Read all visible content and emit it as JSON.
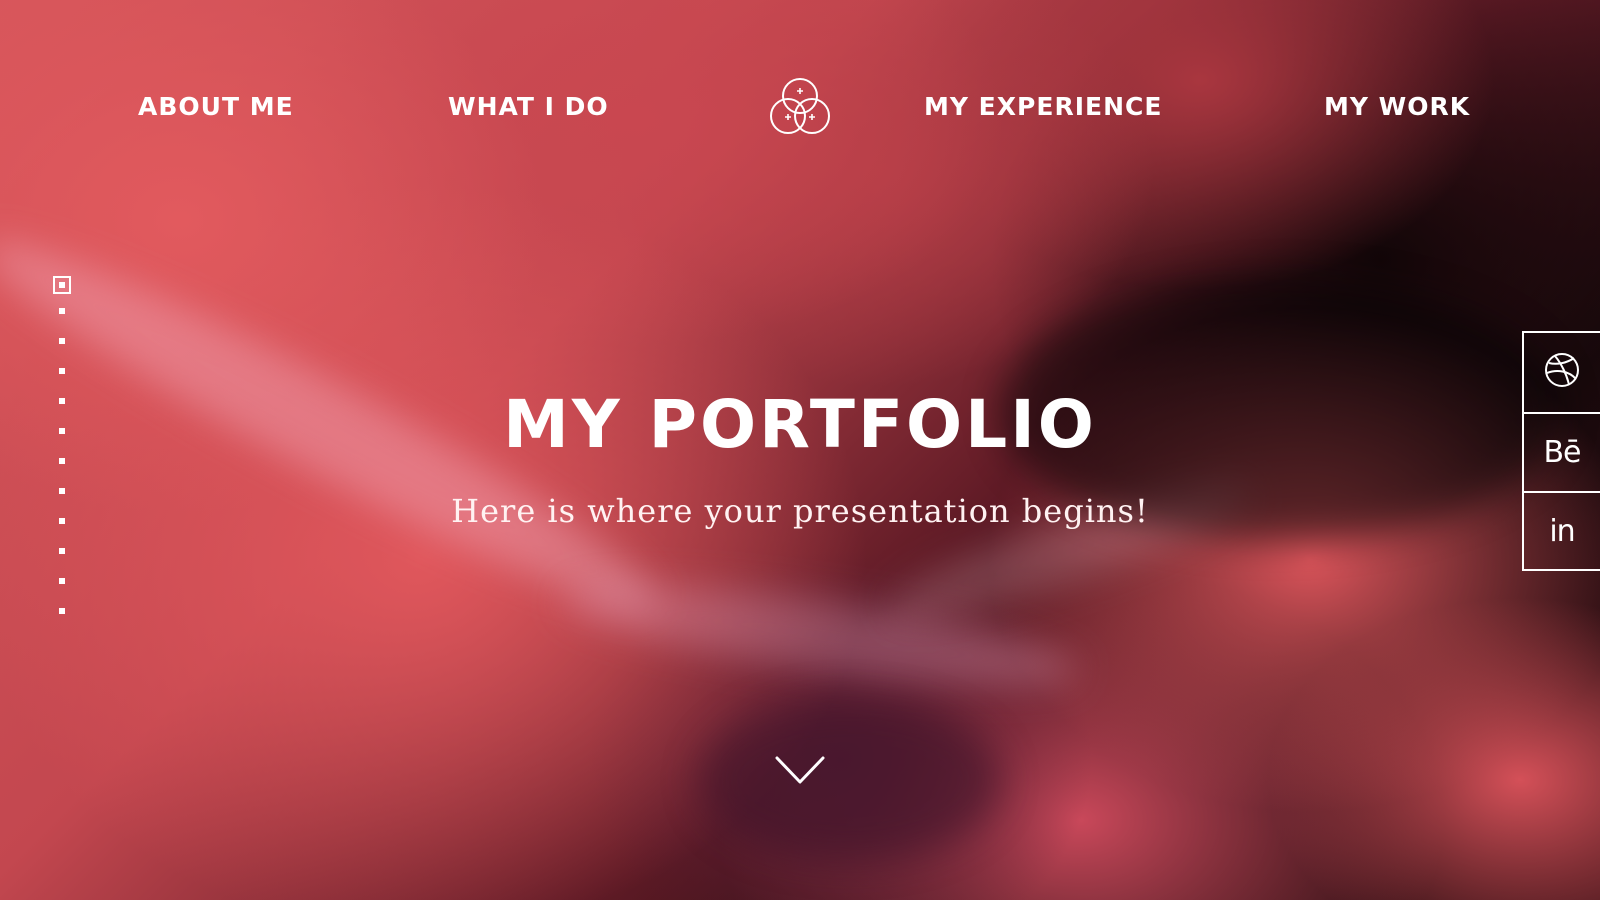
{
  "nav": {
    "items": [
      {
        "label": "ABOUT ME"
      },
      {
        "label": "WHAT I DO"
      },
      {
        "label": "MY EXPERIENCE"
      },
      {
        "label": "MY WORK"
      }
    ],
    "logo_icon": "triple-circle-sparkle-logo"
  },
  "hero": {
    "title": "MY PORTFOLIO",
    "subtitle": "Here is where your presentation begins!"
  },
  "slides": {
    "count": 12,
    "active_index": 0
  },
  "scroll": {
    "icon": "chevron-down-icon"
  },
  "social": {
    "items": [
      {
        "icon": "dribbble-icon"
      },
      {
        "icon": "behance-icon",
        "text": "Bē"
      },
      {
        "icon": "linkedin-icon",
        "text": "in"
      }
    ]
  },
  "colors": {
    "text": "#ffffff",
    "smoke_red": "#d7565b",
    "background_dark": "#1a0a0d"
  }
}
